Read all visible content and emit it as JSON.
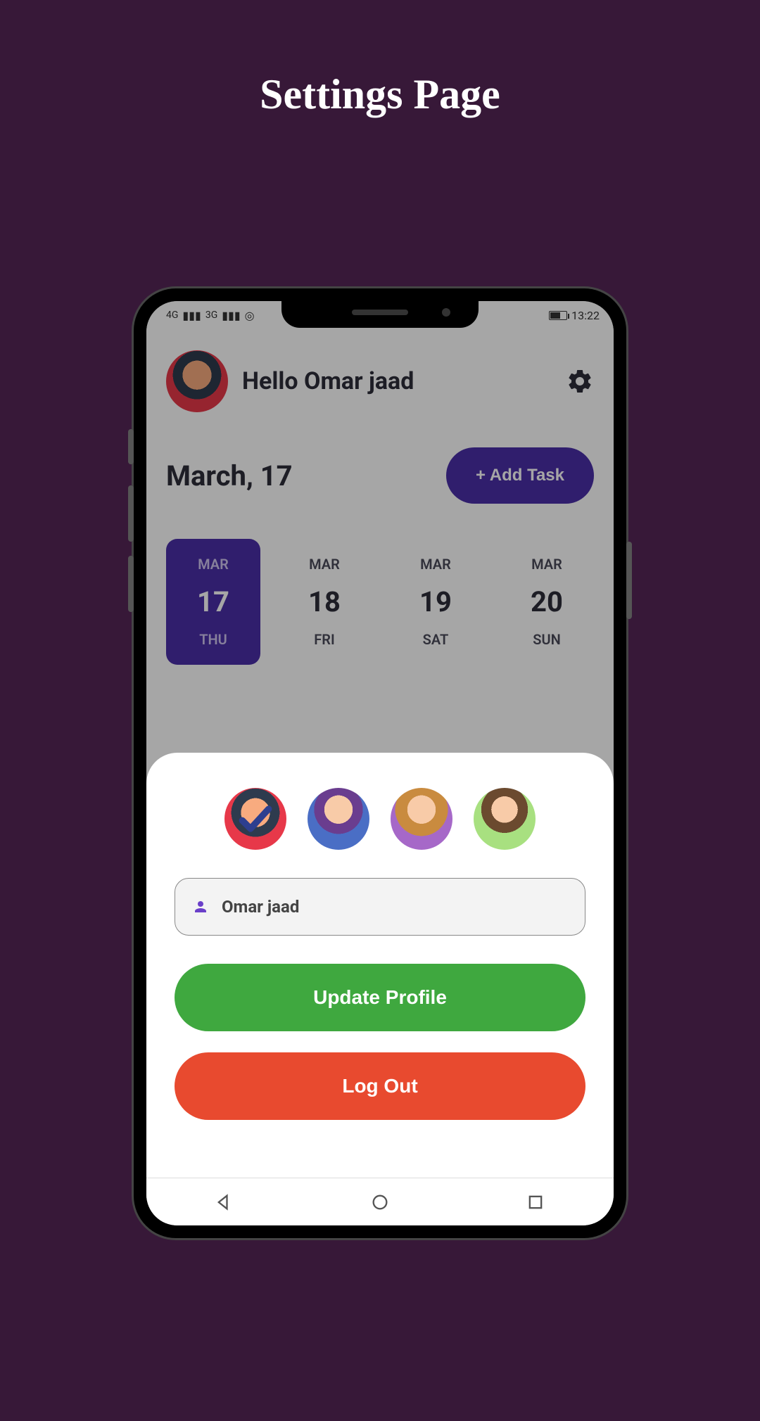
{
  "page": {
    "title": "Settings Page"
  },
  "status_bar": {
    "signal_4g": "4G",
    "signal_3g": "3G",
    "time": "13:22"
  },
  "header": {
    "greeting": "Hello Omar jaad"
  },
  "date_section": {
    "current": "March, 17",
    "add_task_label": "+ Add Task"
  },
  "days": [
    {
      "month": "MAR",
      "num": "17",
      "name": "THU",
      "active": true
    },
    {
      "month": "MAR",
      "num": "18",
      "name": "FRI",
      "active": false
    },
    {
      "month": "MAR",
      "num": "19",
      "name": "SAT",
      "active": false
    },
    {
      "month": "MAR",
      "num": "20",
      "name": "SUN",
      "active": false
    }
  ],
  "sheet": {
    "avatars": [
      {
        "id": "avatar-bearded-man",
        "selected": true
      },
      {
        "id": "avatar-young-man",
        "selected": false
      },
      {
        "id": "avatar-blond-beard",
        "selected": false
      },
      {
        "id": "avatar-woman",
        "selected": false
      }
    ],
    "name_value": "Omar jaad",
    "update_label": "Update Profile",
    "logout_label": "Log Out"
  },
  "colors": {
    "bg": "#371838",
    "accent": "#4a2fa8",
    "green": "#3fa83f",
    "red": "#e84a2f"
  }
}
